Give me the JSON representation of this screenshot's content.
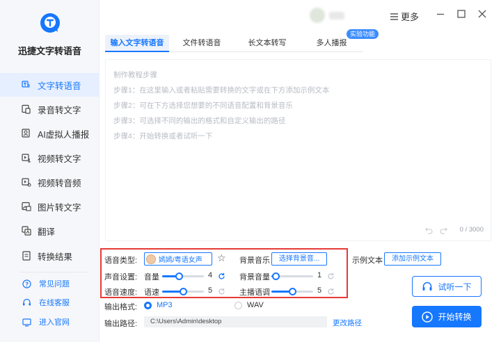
{
  "app": {
    "name": "迅捷文字转语音"
  },
  "sidebar": {
    "items": [
      {
        "label": "文字转语音",
        "icon": "text-to-speech-icon",
        "active": true
      },
      {
        "label": "录音转文字",
        "icon": "recording-to-text-icon"
      },
      {
        "label": "AI虚拟人播报",
        "icon": "ai-avatar-icon"
      },
      {
        "label": "视频转文字",
        "icon": "video-to-text-icon"
      },
      {
        "label": "视频转音频",
        "icon": "video-to-audio-icon"
      },
      {
        "label": "图片转文字",
        "icon": "image-to-text-icon"
      },
      {
        "label": "翻译",
        "icon": "translate-icon"
      },
      {
        "label": "转换结果",
        "icon": "results-icon"
      }
    ],
    "links": [
      {
        "label": "常见问题",
        "icon": "help-icon"
      },
      {
        "label": "在线客服",
        "icon": "customer-service-icon"
      },
      {
        "label": "进入官网",
        "icon": "website-icon"
      }
    ]
  },
  "titlebar": {
    "more_label": "更多"
  },
  "tabs": [
    {
      "label": "输入文字转语音",
      "active": true
    },
    {
      "label": "文件转语音"
    },
    {
      "label": "长文本转写"
    },
    {
      "label": "多人播报"
    }
  ],
  "badge": "实验功能",
  "editor": {
    "placeholder_lines": [
      "制作教程步骤",
      "步骤1：在这里输入或者粘贴需要转换的文字或在下方添加示例文本",
      "步骤2：可在下方选择您想要的不同语音配置和背景音乐",
      "步骤3：可选择不同的输出的格式和自定义输出的路径",
      "步骤4：开始转换或者试听一下"
    ],
    "counter": "0 / 3000"
  },
  "settings": {
    "voice_type_label": "语音类型:",
    "voice_name": "嫣嫣/粤语女声",
    "bgm_label": "背景音乐",
    "bgm_button": "选择背景音...",
    "sample_label": "示例文本",
    "sample_button": "添加示例文本",
    "sound_label": "声音设置:",
    "volume_label": "音量",
    "volume_value": 4,
    "volume_max": 10,
    "bg_volume_label": "背景音量",
    "bg_volume_value": 1,
    "bg_volume_max": 10,
    "speed_section_label": "语音速度:",
    "speed_label": "语速",
    "speed_value": 5,
    "speed_max": 10,
    "pitch_label": "主播语调",
    "pitch_value": 5,
    "pitch_max": 10
  },
  "output": {
    "format_label": "输出格式:",
    "formats": [
      "MP3",
      "WAV"
    ],
    "selected_format": "MP3",
    "path_label": "输出路径:",
    "path_value": "C:\\Users\\Admin\\desktop",
    "change_path": "更改路径"
  },
  "actions": {
    "listen": "试听一下",
    "convert": "开始转换"
  },
  "colors": {
    "accent": "#1677ff",
    "highlight_border": "#e53935",
    "sidebar_bg": "#f6f7fa"
  }
}
